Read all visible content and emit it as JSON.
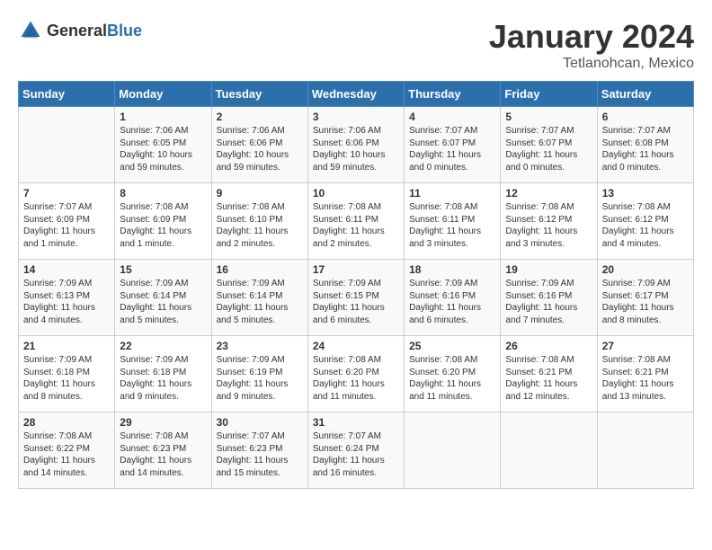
{
  "logo": {
    "text_general": "General",
    "text_blue": "Blue"
  },
  "title": "January 2024",
  "location": "Tetlanohcan, Mexico",
  "days_of_week": [
    "Sunday",
    "Monday",
    "Tuesday",
    "Wednesday",
    "Thursday",
    "Friday",
    "Saturday"
  ],
  "weeks": [
    [
      {
        "day": "",
        "info": ""
      },
      {
        "day": "1",
        "info": "Sunrise: 7:06 AM\nSunset: 6:05 PM\nDaylight: 10 hours\nand 59 minutes."
      },
      {
        "day": "2",
        "info": "Sunrise: 7:06 AM\nSunset: 6:06 PM\nDaylight: 10 hours\nand 59 minutes."
      },
      {
        "day": "3",
        "info": "Sunrise: 7:06 AM\nSunset: 6:06 PM\nDaylight: 10 hours\nand 59 minutes."
      },
      {
        "day": "4",
        "info": "Sunrise: 7:07 AM\nSunset: 6:07 PM\nDaylight: 11 hours\nand 0 minutes."
      },
      {
        "day": "5",
        "info": "Sunrise: 7:07 AM\nSunset: 6:07 PM\nDaylight: 11 hours\nand 0 minutes."
      },
      {
        "day": "6",
        "info": "Sunrise: 7:07 AM\nSunset: 6:08 PM\nDaylight: 11 hours\nand 0 minutes."
      }
    ],
    [
      {
        "day": "7",
        "info": "Sunrise: 7:07 AM\nSunset: 6:09 PM\nDaylight: 11 hours\nand 1 minute."
      },
      {
        "day": "8",
        "info": "Sunrise: 7:08 AM\nSunset: 6:09 PM\nDaylight: 11 hours\nand 1 minute."
      },
      {
        "day": "9",
        "info": "Sunrise: 7:08 AM\nSunset: 6:10 PM\nDaylight: 11 hours\nand 2 minutes."
      },
      {
        "day": "10",
        "info": "Sunrise: 7:08 AM\nSunset: 6:11 PM\nDaylight: 11 hours\nand 2 minutes."
      },
      {
        "day": "11",
        "info": "Sunrise: 7:08 AM\nSunset: 6:11 PM\nDaylight: 11 hours\nand 3 minutes."
      },
      {
        "day": "12",
        "info": "Sunrise: 7:08 AM\nSunset: 6:12 PM\nDaylight: 11 hours\nand 3 minutes."
      },
      {
        "day": "13",
        "info": "Sunrise: 7:08 AM\nSunset: 6:12 PM\nDaylight: 11 hours\nand 4 minutes."
      }
    ],
    [
      {
        "day": "14",
        "info": "Sunrise: 7:09 AM\nSunset: 6:13 PM\nDaylight: 11 hours\nand 4 minutes."
      },
      {
        "day": "15",
        "info": "Sunrise: 7:09 AM\nSunset: 6:14 PM\nDaylight: 11 hours\nand 5 minutes."
      },
      {
        "day": "16",
        "info": "Sunrise: 7:09 AM\nSunset: 6:14 PM\nDaylight: 11 hours\nand 5 minutes."
      },
      {
        "day": "17",
        "info": "Sunrise: 7:09 AM\nSunset: 6:15 PM\nDaylight: 11 hours\nand 6 minutes."
      },
      {
        "day": "18",
        "info": "Sunrise: 7:09 AM\nSunset: 6:16 PM\nDaylight: 11 hours\nand 6 minutes."
      },
      {
        "day": "19",
        "info": "Sunrise: 7:09 AM\nSunset: 6:16 PM\nDaylight: 11 hours\nand 7 minutes."
      },
      {
        "day": "20",
        "info": "Sunrise: 7:09 AM\nSunset: 6:17 PM\nDaylight: 11 hours\nand 8 minutes."
      }
    ],
    [
      {
        "day": "21",
        "info": "Sunrise: 7:09 AM\nSunset: 6:18 PM\nDaylight: 11 hours\nand 8 minutes."
      },
      {
        "day": "22",
        "info": "Sunrise: 7:09 AM\nSunset: 6:18 PM\nDaylight: 11 hours\nand 9 minutes."
      },
      {
        "day": "23",
        "info": "Sunrise: 7:09 AM\nSunset: 6:19 PM\nDaylight: 11 hours\nand 9 minutes."
      },
      {
        "day": "24",
        "info": "Sunrise: 7:08 AM\nSunset: 6:20 PM\nDaylight: 11 hours\nand 11 minutes."
      },
      {
        "day": "25",
        "info": "Sunrise: 7:08 AM\nSunset: 6:20 PM\nDaylight: 11 hours\nand 11 minutes."
      },
      {
        "day": "26",
        "info": "Sunrise: 7:08 AM\nSunset: 6:21 PM\nDaylight: 11 hours\nand 12 minutes."
      },
      {
        "day": "27",
        "info": "Sunrise: 7:08 AM\nSunset: 6:21 PM\nDaylight: 11 hours\nand 13 minutes."
      }
    ],
    [
      {
        "day": "28",
        "info": "Sunrise: 7:08 AM\nSunset: 6:22 PM\nDaylight: 11 hours\nand 14 minutes."
      },
      {
        "day": "29",
        "info": "Sunrise: 7:08 AM\nSunset: 6:23 PM\nDaylight: 11 hours\nand 14 minutes."
      },
      {
        "day": "30",
        "info": "Sunrise: 7:07 AM\nSunset: 6:23 PM\nDaylight: 11 hours\nand 15 minutes."
      },
      {
        "day": "31",
        "info": "Sunrise: 7:07 AM\nSunset: 6:24 PM\nDaylight: 11 hours\nand 16 minutes."
      },
      {
        "day": "",
        "info": ""
      },
      {
        "day": "",
        "info": ""
      },
      {
        "day": "",
        "info": ""
      }
    ]
  ]
}
